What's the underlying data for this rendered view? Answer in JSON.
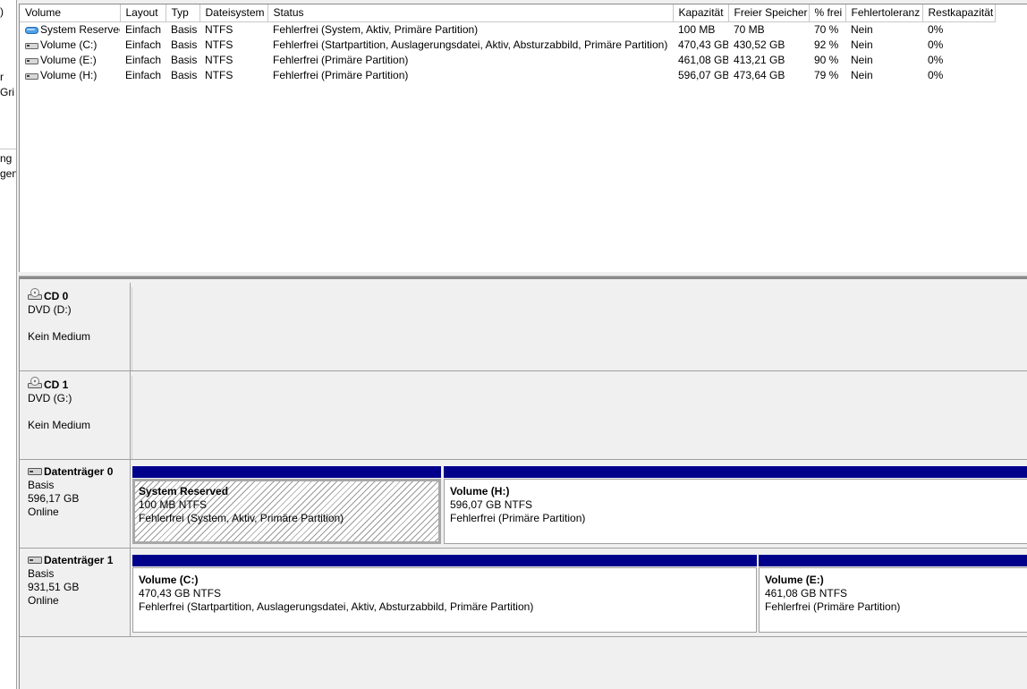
{
  "left_pane": {
    "fragments": [
      ")",
      "r",
      "Gri",
      "ng",
      "gen"
    ]
  },
  "volume_list": {
    "columns": [
      "Volume",
      "Layout",
      "Typ",
      "Dateisystem",
      "Status",
      "Kapazität",
      "Freier Speicher",
      "% frei",
      "Fehlertoleranz",
      "Restkapazität"
    ],
    "rows": [
      {
        "volume": "System Reserved",
        "layout": "Einfach",
        "typ": "Basis",
        "fs": "NTFS",
        "status": "Fehlerfrei (System, Aktiv, Primäre Partition)",
        "capacity": "100 MB",
        "free": "70 MB",
        "pct": "70 %",
        "fault": "Nein",
        "overhead": "0%",
        "icon": "blue-volume-icon"
      },
      {
        "volume": "Volume (C:)",
        "layout": "Einfach",
        "typ": "Basis",
        "fs": "NTFS",
        "status": "Fehlerfrei (Startpartition, Auslagerungsdatei, Aktiv, Absturzabbild, Primäre Partition)",
        "capacity": "470,43 GB",
        "free": "430,52 GB",
        "pct": "92 %",
        "fault": "Nein",
        "overhead": "0%",
        "icon": "drive-icon"
      },
      {
        "volume": "Volume (E:)",
        "layout": "Einfach",
        "typ": "Basis",
        "fs": "NTFS",
        "status": "Fehlerfrei (Primäre Partition)",
        "capacity": "461,08 GB",
        "free": "413,21 GB",
        "pct": "90 %",
        "fault": "Nein",
        "overhead": "0%",
        "icon": "drive-icon"
      },
      {
        "volume": "Volume (H:)",
        "layout": "Einfach",
        "typ": "Basis",
        "fs": "NTFS",
        "status": "Fehlerfrei (Primäre Partition)",
        "capacity": "596,07 GB",
        "free": "473,64 GB",
        "pct": "79 %",
        "fault": "Nein",
        "overhead": "0%",
        "icon": "drive-icon"
      }
    ]
  },
  "disks": [
    {
      "name": "CD 0",
      "line1": "DVD (D:)",
      "line2": "",
      "line3": "Kein Medium",
      "icon": "cd-drive-icon"
    },
    {
      "name": "CD 1",
      "line1": "DVD (G:)",
      "line2": "",
      "line3": "Kein Medium",
      "icon": "cd-drive-icon"
    },
    {
      "name": "Datenträger 0",
      "line1": "Basis",
      "line2": "596,17 GB",
      "line3": "Online",
      "icon": "hard-disk-icon",
      "partitions": [
        {
          "name": "System Reserved",
          "size": "100 MB NTFS",
          "status": "Fehlerfrei (System, Aktiv, Primäre Partition)"
        },
        {
          "name": "Volume  (H:)",
          "size": "596,07 GB NTFS",
          "status": "Fehlerfrei (Primäre Partition)"
        }
      ]
    },
    {
      "name": "Datenträger 1",
      "line1": "Basis",
      "line2": "931,51 GB",
      "line3": "Online",
      "icon": "hard-disk-icon",
      "partitions": [
        {
          "name": "Volume  (C:)",
          "size": "470,43 GB NTFS",
          "status": "Fehlerfrei (Startpartition, Auslagerungsdatei, Aktiv, Absturzabbild, Primäre Partition)"
        },
        {
          "name": "Volume  (E:)",
          "size": "461,08 GB NTFS",
          "status": "Fehlerfrei (Primäre Partition)"
        }
      ]
    }
  ],
  "colors": {
    "partition_bar": "#00008b",
    "border": "#a0a0a0",
    "background": "#f0f0f0"
  }
}
